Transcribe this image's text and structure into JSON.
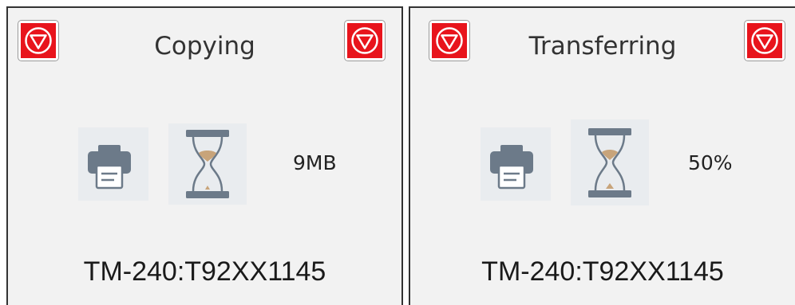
{
  "panels": [
    {
      "title": "Copying",
      "value": "9MB",
      "device_id": "TM-240:T92XX1145",
      "icons": {
        "left_button": "stop-icon",
        "right_button": "stop-icon",
        "device": "printer-icon",
        "status": "hourglass-icon"
      }
    },
    {
      "title": "Transferring",
      "value": "50%",
      "device_id": "TM-240:T92XX1145",
      "icons": {
        "left_button": "stop-icon",
        "right_button": "stop-icon",
        "device": "printer-icon",
        "status": "hourglass-icon"
      }
    }
  ],
  "colors": {
    "stop_red": "#e8141c",
    "panel_background": "#f2f2f2",
    "printer_gray": "#6c7a89",
    "hourglass_sand": "#c8a47a"
  }
}
